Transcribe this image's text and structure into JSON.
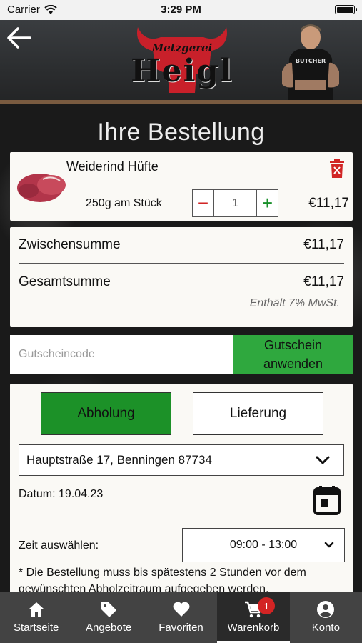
{
  "status_bar": {
    "carrier": "Carrier",
    "time": "3:29 PM"
  },
  "header": {
    "logo_line1": "Metzgerei",
    "logo_line2": "Heigl",
    "person_shirt_text": "BUTCHER"
  },
  "page_title": "Ihre Bestellung",
  "cart_item": {
    "name": "Weiderind Hüfte",
    "variant": "250g am Stück",
    "quantity": "1",
    "price": "€11,17"
  },
  "totals": {
    "subtotal_label": "Zwischensumme",
    "subtotal_value": "€11,17",
    "total_label": "Gesamtsumme",
    "total_value": "€11,17",
    "tax_note": "Enthält 7% MwSt."
  },
  "voucher": {
    "placeholder": "Gutscheincode",
    "apply_label": "Gutschein anwenden"
  },
  "fulfillment": {
    "pickup_label": "Abholung",
    "delivery_label": "Lieferung",
    "address": "Hauptstraße 17, Benningen 87734",
    "date_text": "Datum: 19.04.23",
    "time_label": "Zeit auswählen:",
    "time_value": "09:00 - 13:00",
    "note": "* Die Bestellung muss bis spätestens 2 Stunden vor dem gewünschten Abholzeitraum aufgegeben werden."
  },
  "tabbar": {
    "tabs": [
      {
        "label": "Startseite",
        "icon": "home-icon"
      },
      {
        "label": "Angebote",
        "icon": "tag-icon"
      },
      {
        "label": "Favoriten",
        "icon": "heart-icon"
      },
      {
        "label": "Warenkorb",
        "icon": "cart-icon"
      },
      {
        "label": "Konto",
        "icon": "account-icon"
      }
    ],
    "cart_badge": "1"
  },
  "colors": {
    "accent_green": "#2fa83e",
    "active_green": "#1c9128",
    "danger_red": "#d12525",
    "tabbar_bg": "#434343"
  }
}
